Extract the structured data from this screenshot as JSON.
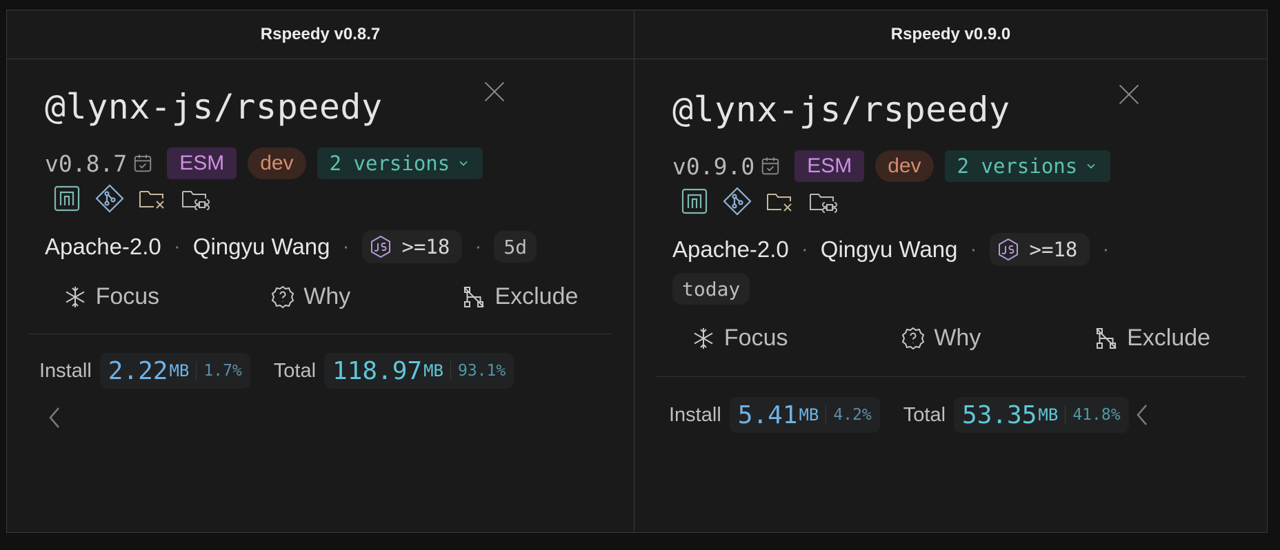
{
  "panels": [
    {
      "header": "Rspeedy v0.8.7",
      "package_name": "@lynx-js/rspeedy",
      "version": "v0.8.7",
      "badges": {
        "esm": "ESM",
        "dev": "dev",
        "versions": "2 versions"
      },
      "license": "Apache-2.0",
      "author": "Qingyu Wang",
      "node_req": ">=18",
      "published": "5d",
      "actions": {
        "focus": "Focus",
        "why": "Why",
        "exclude": "Exclude"
      },
      "install": {
        "label": "Install",
        "value": "2.22",
        "unit": "MB",
        "pct": "1.7%"
      },
      "total": {
        "label": "Total",
        "value": "118.97",
        "unit": "MB",
        "pct": "93.1%"
      }
    },
    {
      "header": "Rspeedy v0.9.0",
      "package_name": "@lynx-js/rspeedy",
      "version": "v0.9.0",
      "badges": {
        "esm": "ESM",
        "dev": "dev",
        "versions": "2 versions"
      },
      "license": "Apache-2.0",
      "author": "Qingyu Wang",
      "node_req": ">=18",
      "published": "today",
      "actions": {
        "focus": "Focus",
        "why": "Why",
        "exclude": "Exclude"
      },
      "install": {
        "label": "Install",
        "value": "5.41",
        "unit": "MB",
        "pct": "4.2%"
      },
      "total": {
        "label": "Total",
        "value": "53.35",
        "unit": "MB",
        "pct": "41.8%"
      }
    }
  ],
  "separator": "·",
  "icons": [
    "npm-icon",
    "git-icon",
    "folder-x-icon",
    "folder-command-icon",
    "calendar-check-icon",
    "nodejs-icon",
    "snowflake-icon",
    "help-badge-icon",
    "exclude-tree-icon",
    "chevron-left-icon",
    "close-icon",
    "chevron-down-icon"
  ],
  "colors": {
    "background": "#1a1a1a",
    "esm": "#d18fe3",
    "dev": "#d98c6f",
    "versions": "#5fc1b2",
    "install": "#6fb3e6",
    "total": "#5fc8d8"
  }
}
